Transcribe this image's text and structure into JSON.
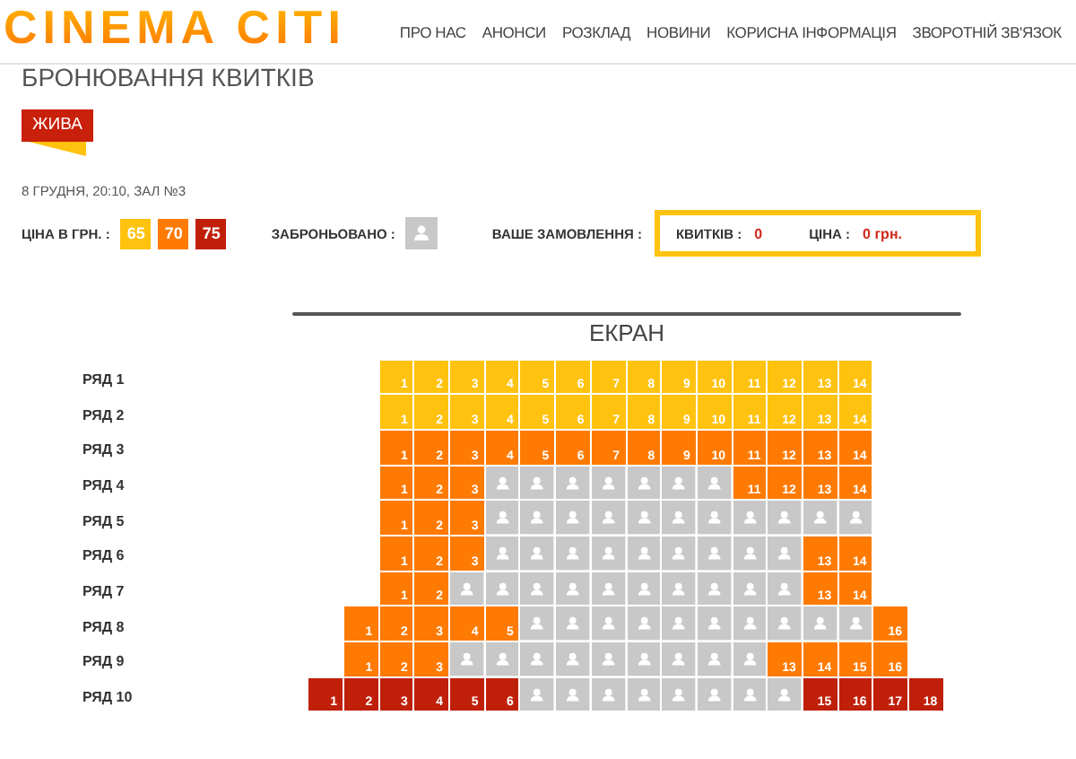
{
  "logo": "CINEMA CITI",
  "nav": [
    "ПРО НАС",
    "АНОНСИ",
    "РОЗКЛАД",
    "НОВИНИ",
    "КОРИСНА ІНФОРМАЦІЯ",
    "ЗВОРОТНІЙ ЗВ'ЯЗОК"
  ],
  "title": "БРОНЮВАННЯ КВИТКІВ",
  "film_badge": "ЖИВА",
  "session": "8 ГРУДНЯ, 20:10, ЗАЛ №3",
  "legend": {
    "price_label": "ЦІНА В ГРН. :",
    "prices": [
      {
        "value": "65",
        "color": "#ffc20e"
      },
      {
        "value": "70",
        "color": "#ff7a00"
      },
      {
        "value": "75",
        "color": "#c0200a"
      }
    ],
    "booked_label": "ЗАБРОНЬОВАНО :"
  },
  "order": {
    "label": "ВАШЕ ЗАМОВЛЕННЯ :",
    "tickets_label": "КВИТКІВ :",
    "tickets": "0",
    "price_label": "ЦІНА :",
    "price": "0 грн."
  },
  "screen": "ЕКРАН",
  "rows": [
    {
      "label": "РЯД 1",
      "seats": [
        {
          "booked": false,
          "number": "1",
          "color": "#ffc20e"
        },
        {
          "booked": false,
          "number": "2",
          "color": "#ffc20e"
        },
        {
          "booked": false,
          "number": "3",
          "color": "#ffc20e"
        },
        {
          "booked": false,
          "number": "4",
          "color": "#ffc20e"
        },
        {
          "booked": false,
          "number": "5",
          "color": "#ffc20e"
        },
        {
          "booked": false,
          "number": "6",
          "color": "#ffc20e"
        },
        {
          "booked": false,
          "number": "7",
          "color": "#ffc20e"
        },
        {
          "booked": false,
          "number": "8",
          "color": "#ffc20e"
        },
        {
          "booked": false,
          "number": "9",
          "color": "#ffc20e"
        },
        {
          "booked": false,
          "number": "10",
          "color": "#ffc20e"
        },
        {
          "booked": false,
          "number": "11",
          "color": "#ffc20e"
        },
        {
          "booked": false,
          "number": "12",
          "color": "#ffc20e"
        },
        {
          "booked": false,
          "number": "13",
          "color": "#ffc20e"
        },
        {
          "booked": false,
          "number": "14",
          "color": "#ffc20e"
        }
      ]
    },
    {
      "label": "РЯД 2",
      "seats": [
        {
          "booked": false,
          "number": "1",
          "color": "#ffc20e"
        },
        {
          "booked": false,
          "number": "2",
          "color": "#ffc20e"
        },
        {
          "booked": false,
          "number": "3",
          "color": "#ffc20e"
        },
        {
          "booked": false,
          "number": "4",
          "color": "#ffc20e"
        },
        {
          "booked": false,
          "number": "5",
          "color": "#ffc20e"
        },
        {
          "booked": false,
          "number": "6",
          "color": "#ffc20e"
        },
        {
          "booked": false,
          "number": "7",
          "color": "#ffc20e"
        },
        {
          "booked": false,
          "number": "8",
          "color": "#ffc20e"
        },
        {
          "booked": false,
          "number": "9",
          "color": "#ffc20e"
        },
        {
          "booked": false,
          "number": "10",
          "color": "#ffc20e"
        },
        {
          "booked": false,
          "number": "11",
          "color": "#ffc20e"
        },
        {
          "booked": false,
          "number": "12",
          "color": "#ffc20e"
        },
        {
          "booked": false,
          "number": "13",
          "color": "#ffc20e"
        },
        {
          "booked": false,
          "number": "14",
          "color": "#ffc20e"
        }
      ]
    },
    {
      "label": "РЯД 3",
      "seats": [
        {
          "booked": false,
          "number": "1",
          "color": "#ff7a00"
        },
        {
          "booked": false,
          "number": "2",
          "color": "#ff7a00"
        },
        {
          "booked": false,
          "number": "3",
          "color": "#ff7a00"
        },
        {
          "booked": false,
          "number": "4",
          "color": "#ff7a00"
        },
        {
          "booked": false,
          "number": "5",
          "color": "#ff7a00"
        },
        {
          "booked": false,
          "number": "6",
          "color": "#ff7a00"
        },
        {
          "booked": false,
          "number": "7",
          "color": "#ff7a00"
        },
        {
          "booked": false,
          "number": "8",
          "color": "#ff7a00"
        },
        {
          "booked": false,
          "number": "9",
          "color": "#ff7a00"
        },
        {
          "booked": false,
          "number": "10",
          "color": "#ff7a00"
        },
        {
          "booked": false,
          "number": "11",
          "color": "#ff7a00"
        },
        {
          "booked": false,
          "number": "12",
          "color": "#ff7a00"
        },
        {
          "booked": false,
          "number": "13",
          "color": "#ff7a00"
        },
        {
          "booked": false,
          "number": "14",
          "color": "#ff7a00"
        }
      ]
    },
    {
      "label": "РЯД 4",
      "seats": [
        {
          "booked": false,
          "number": "1",
          "color": "#ff7a00"
        },
        {
          "booked": false,
          "number": "2",
          "color": "#ff7a00"
        },
        {
          "booked": false,
          "number": "3",
          "color": "#ff7a00"
        },
        {
          "booked": true
        },
        {
          "booked": true
        },
        {
          "booked": true
        },
        {
          "booked": true
        },
        {
          "booked": true
        },
        {
          "booked": true
        },
        {
          "booked": true
        },
        {
          "booked": false,
          "number": "11",
          "color": "#ff7a00"
        },
        {
          "booked": false,
          "number": "12",
          "color": "#ff7a00"
        },
        {
          "booked": false,
          "number": "13",
          "color": "#ff7a00"
        },
        {
          "booked": false,
          "number": "14",
          "color": "#ff7a00"
        }
      ]
    },
    {
      "label": "РЯД 5",
      "seats": [
        {
          "booked": false,
          "number": "1",
          "color": "#ff7a00"
        },
        {
          "booked": false,
          "number": "2",
          "color": "#ff7a00"
        },
        {
          "booked": false,
          "number": "3",
          "color": "#ff7a00"
        },
        {
          "booked": true
        },
        {
          "booked": true
        },
        {
          "booked": true
        },
        {
          "booked": true
        },
        {
          "booked": true
        },
        {
          "booked": true
        },
        {
          "booked": true
        },
        {
          "booked": true
        },
        {
          "booked": true
        },
        {
          "booked": true
        },
        {
          "booked": true
        }
      ]
    },
    {
      "label": "РЯД 6",
      "seats": [
        {
          "booked": false,
          "number": "1",
          "color": "#ff7a00"
        },
        {
          "booked": false,
          "number": "2",
          "color": "#ff7a00"
        },
        {
          "booked": false,
          "number": "3",
          "color": "#ff7a00"
        },
        {
          "booked": true
        },
        {
          "booked": true
        },
        {
          "booked": true
        },
        {
          "booked": true
        },
        {
          "booked": true
        },
        {
          "booked": true
        },
        {
          "booked": true
        },
        {
          "booked": true
        },
        {
          "booked": true
        },
        {
          "booked": false,
          "number": "13",
          "color": "#ff7a00"
        },
        {
          "booked": false,
          "number": "14",
          "color": "#ff7a00"
        }
      ]
    },
    {
      "label": "РЯД 7",
      "seats": [
        {
          "booked": false,
          "number": "1",
          "color": "#ff7a00"
        },
        {
          "booked": false,
          "number": "2",
          "color": "#ff7a00"
        },
        {
          "booked": true
        },
        {
          "booked": true
        },
        {
          "booked": true
        },
        {
          "booked": true
        },
        {
          "booked": true
        },
        {
          "booked": true
        },
        {
          "booked": true
        },
        {
          "booked": true
        },
        {
          "booked": true
        },
        {
          "booked": true
        },
        {
          "booked": false,
          "number": "13",
          "color": "#ff7a00"
        },
        {
          "booked": false,
          "number": "14",
          "color": "#ff7a00"
        }
      ]
    },
    {
      "label": "РЯД 8",
      "seats": [
        {
          "booked": false,
          "number": "1",
          "color": "#ff7a00"
        },
        {
          "booked": false,
          "number": "2",
          "color": "#ff7a00"
        },
        {
          "booked": false,
          "number": "3",
          "color": "#ff7a00"
        },
        {
          "booked": false,
          "number": "4",
          "color": "#ff7a00"
        },
        {
          "booked": false,
          "number": "5",
          "color": "#ff7a00"
        },
        {
          "booked": true
        },
        {
          "booked": true
        },
        {
          "booked": true
        },
        {
          "booked": true
        },
        {
          "booked": true
        },
        {
          "booked": true
        },
        {
          "booked": true
        },
        {
          "booked": true
        },
        {
          "booked": true
        },
        {
          "booked": true
        },
        {
          "booked": false,
          "number": "16",
          "color": "#ff7a00"
        }
      ]
    },
    {
      "label": "РЯД 9",
      "seats": [
        {
          "booked": false,
          "number": "1",
          "color": "#ff7a00"
        },
        {
          "booked": false,
          "number": "2",
          "color": "#ff7a00"
        },
        {
          "booked": false,
          "number": "3",
          "color": "#ff7a00"
        },
        {
          "booked": true
        },
        {
          "booked": true
        },
        {
          "booked": true
        },
        {
          "booked": true
        },
        {
          "booked": true
        },
        {
          "booked": true
        },
        {
          "booked": true
        },
        {
          "booked": true
        },
        {
          "booked": true
        },
        {
          "booked": false,
          "number": "13",
          "color": "#ff7a00"
        },
        {
          "booked": false,
          "number": "14",
          "color": "#ff7a00"
        },
        {
          "booked": false,
          "number": "15",
          "color": "#ff7a00"
        },
        {
          "booked": false,
          "number": "16",
          "color": "#ff7a00"
        }
      ]
    },
    {
      "label": "РЯД 10",
      "seats": [
        {
          "booked": false,
          "number": "1",
          "color": "#c0200a"
        },
        {
          "booked": false,
          "number": "2",
          "color": "#c0200a"
        },
        {
          "booked": false,
          "number": "3",
          "color": "#c0200a"
        },
        {
          "booked": false,
          "number": "4",
          "color": "#c0200a"
        },
        {
          "booked": false,
          "number": "5",
          "color": "#c0200a"
        },
        {
          "booked": false,
          "number": "6",
          "color": "#c0200a"
        },
        {
          "booked": true
        },
        {
          "booked": true
        },
        {
          "booked": true
        },
        {
          "booked": true
        },
        {
          "booked": true
        },
        {
          "booked": true
        },
        {
          "booked": true
        },
        {
          "booked": true
        },
        {
          "booked": false,
          "number": "15",
          "color": "#c0200a"
        },
        {
          "booked": false,
          "number": "16",
          "color": "#c0200a"
        },
        {
          "booked": false,
          "number": "17",
          "color": "#c0200a"
        },
        {
          "booked": false,
          "number": "18",
          "color": "#c0200a"
        }
      ]
    }
  ]
}
